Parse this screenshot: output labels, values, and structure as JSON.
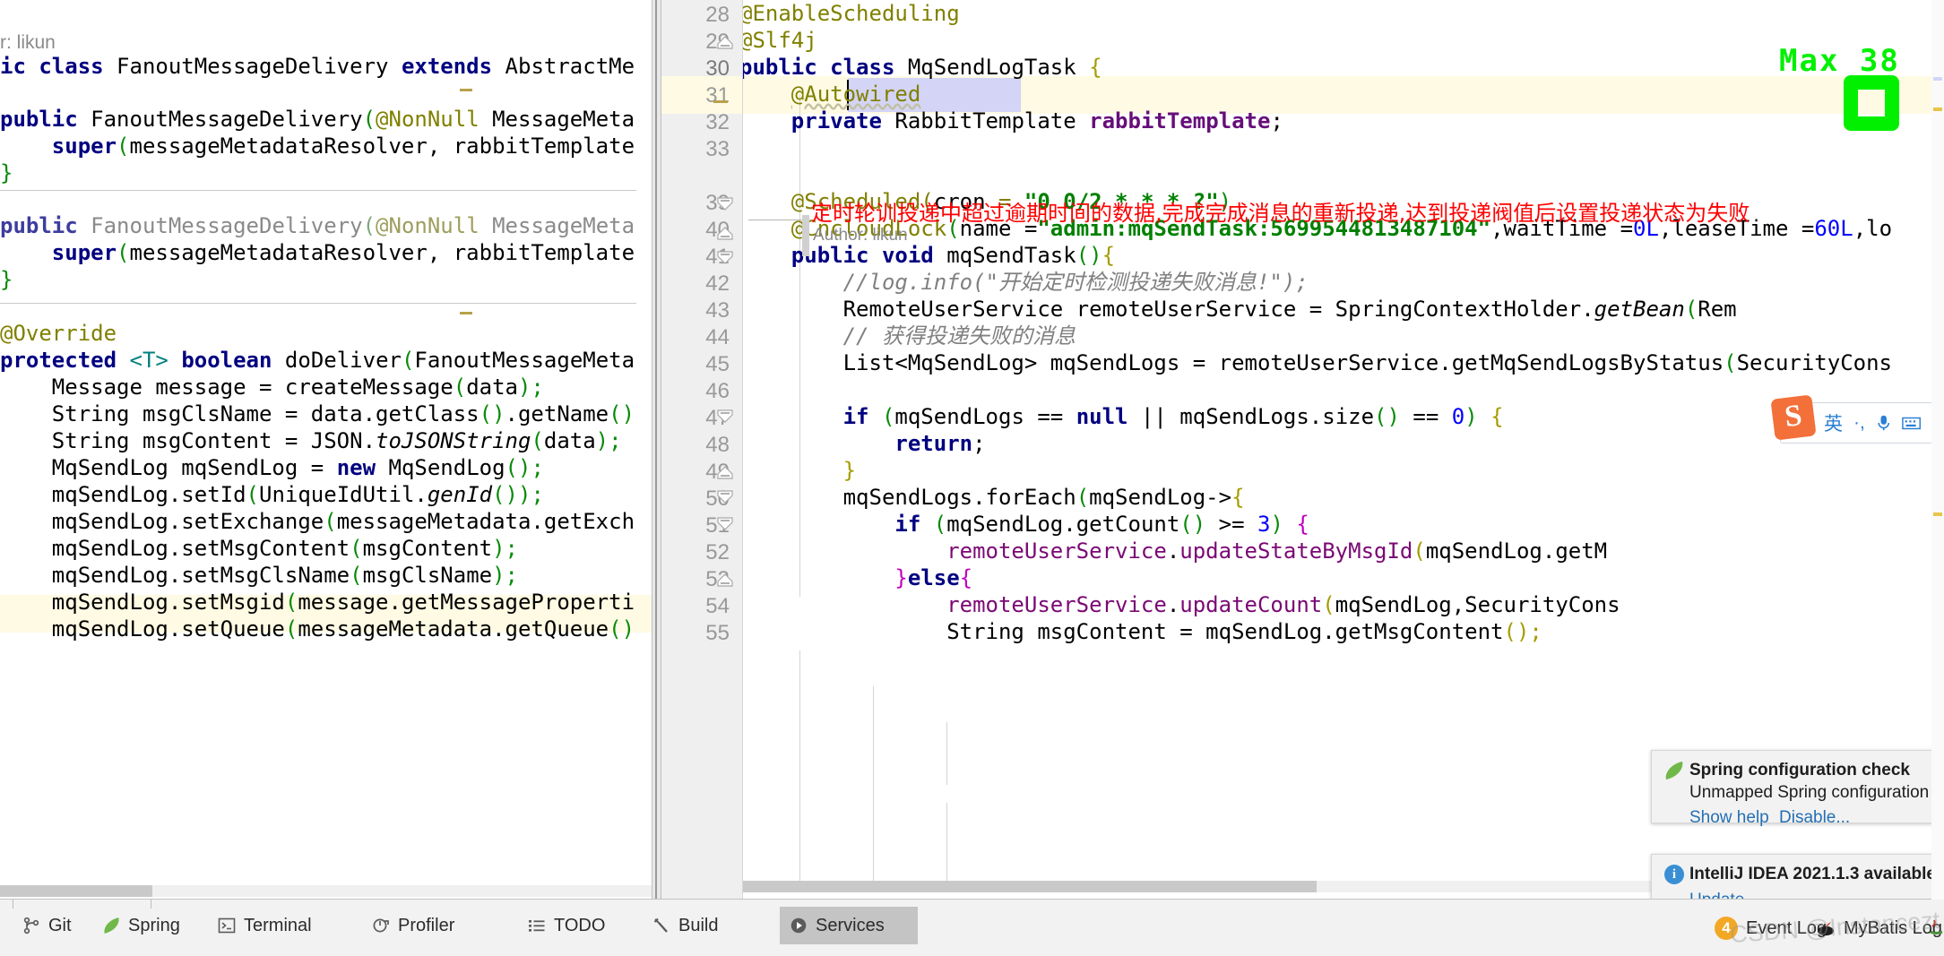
{
  "left_editor": {
    "author_hint": "r: likun",
    "lines": [
      "ic class FanoutMessageDelivery extends AbstractMe",
      "",
      "public FanoutMessageDelivery(@NonNull MessageMeta",
      "    super(messageMetadataResolver, rabbitTemplate",
      "}",
      "",
      "public FanoutMessageDelivery(@NonNull MessageMeta",
      "    super(messageMetadataResolver, rabbitTemplate",
      "}",
      "",
      "@Override",
      "protected <T> boolean doDeliver(FanoutMessageMeta",
      "    Message message = createMessage(data);",
      "    String msgClsName = data.getClass().getName()",
      "    String msgContent = JSON.toJSONString(data);",
      "    MqSendLog mqSendLog = new MqSendLog();",
      "    mqSendLog.setId(UniqueIdUtil.genId());",
      "    mqSendLog.setExchange(messageMetadata.getExch",
      "    mqSendLog.setMsgContent(msgContent);",
      "    mqSendLog.setMsgClsName(msgClsName);",
      "    mqSendLog.setMsgid(message.getMessageProperti",
      "    mqSendLog.setQueue(messageMetadata.getQueue()"
    ]
  },
  "right_editor": {
    "line_numbers": [
      "28",
      "29",
      "30",
      "31",
      "32",
      "33",
      "39",
      "40",
      "41",
      "42",
      "43",
      "44",
      "45",
      "46",
      "47",
      "48",
      "49",
      "50",
      "51",
      "52",
      "53",
      "54",
      "55"
    ],
    "current_line": "30",
    "selected_token": "MqSendLogTask",
    "code": [
      "@EnableScheduling",
      "@Slf4j",
      "public class MqSendLogTask {",
      "    @Autowired",
      "    private RabbitTemplate rabbitTemplate;",
      "",
      "    @Scheduled(cron = \"0 0/2 * * * ?\")",
      "    @CncloudLock(name =\"admin:mqSendTask:5699544813487104\",waitTime =0L,leaseTime =60L,lo",
      "    public void mqSendTask(){",
      "        //log.info(\"开始定时检测投递失败消息!\");",
      "        RemoteUserService remoteUserService = SpringContextHolder.getBean(Rem",
      "        // 获得投递失败的消息",
      "        List<MqSendLog> mqSendLogs = remoteUserService.getMqSendLogsByStatus(SecurityCons",
      "",
      "        if (mqSendLogs == null || mqSendLogs.size() == 0) {",
      "            return;",
      "        }",
      "        mqSendLogs.forEach(mqSendLog->{",
      "            if (mqSendLog.getCount() >= 3) {",
      "                remoteUserService.updateStateByMsgId(mqSendLog.getM",
      "            }else{",
      "                remoteUserService.updateCount(mqSendLog,SecurityCons",
      "                String msgContent = mqSendLog.getMsgContent();"
    ]
  },
  "doc_fold": {
    "comment": "定时轮训投递中超过逾期时间的数据,完成完成消息的重新投递,达到投递阀值后设置投递状态为失败",
    "author": "Author: likun"
  },
  "notifications": [
    {
      "icon": "spring-leaf-icon",
      "title": "Spring configuration check",
      "body": "Unmapped Spring configuration files fo",
      "actions": [
        "Show help",
        "Disable..."
      ]
    },
    {
      "icon": "info-icon",
      "title": "IntelliJ IDEA 2021.1.3 available",
      "actions": [
        "Update..."
      ]
    }
  ],
  "bottom_bar": {
    "tools": [
      {
        "label": "Git",
        "icon": "branch-icon",
        "active": false
      },
      {
        "label": "Spring",
        "icon": "spring-leaf-icon",
        "active": false
      },
      {
        "label": "Terminal",
        "icon": "terminal-icon",
        "active": false
      },
      {
        "label": "Profiler",
        "icon": "profiler-icon",
        "active": false
      },
      {
        "label": "TODO",
        "icon": "todo-list-icon",
        "active": false
      },
      {
        "label": "Build",
        "icon": "hammer-icon",
        "active": false
      },
      {
        "label": "Services",
        "icon": "play-circle-icon",
        "active": true
      }
    ],
    "status": [
      {
        "label": "Event Log",
        "badge": "4",
        "icon": "event-log-icon"
      },
      {
        "label": "MyBatis Log",
        "icon": "mybatis-icon"
      }
    ]
  },
  "ime": {
    "logo": "S",
    "items": [
      "英",
      "·,",
      "mic-icon",
      "keyboard-icon",
      "toolbox-icon"
    ]
  },
  "recorder_overlay": {
    "text": "Max 38",
    "value": "0"
  },
  "watermark": "CSDN @Instancezt",
  "colors": {
    "keyword": "#000080",
    "annotation": "#808000",
    "string": "#008000",
    "number": "#0000ff",
    "field": "#660e7a",
    "method": "#7a0874",
    "comment": "#808080",
    "doc_red": "#ff0000",
    "current_line_bg": "#fffae3",
    "selection_bg": "#d4d4f7",
    "gutter_bg": "#efefef",
    "toolbar_bg": "#f2f2f2"
  }
}
